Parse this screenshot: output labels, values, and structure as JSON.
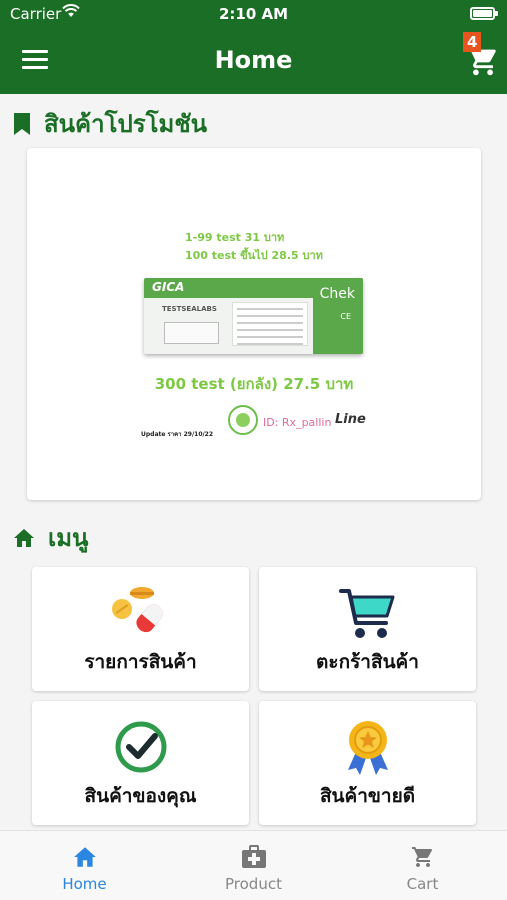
{
  "status_bar": {
    "carrier": "Carrier",
    "time": "2:10 AM"
  },
  "app_bar": {
    "title": "Home",
    "cart_badge": "4"
  },
  "promotion": {
    "heading": "สินค้าโปรโมชัน",
    "banner": {
      "line1": "1-99 test 31 บาท",
      "line2": "100  test ขึ้นไป 28.5 บาท",
      "main": "300 test (ยกลัง) 27.5 บาท",
      "update": "Update ราคา 29/10/22",
      "line_id": "ID: Rx_pallin",
      "line_brand": "Line",
      "kit_name": "GICA",
      "kit_brand": "TESTSEALABS",
      "kit_chek": "Chek",
      "kit_ce": "CE"
    }
  },
  "menu": {
    "heading": "เมนู",
    "items": [
      {
        "label": "รายการสินค้า",
        "icon": "pills-icon"
      },
      {
        "label": "ตะกร้าสินค้า",
        "icon": "shopping-cart-icon"
      },
      {
        "label": "สินค้าของคุณ",
        "icon": "check-circle-icon"
      },
      {
        "label": "สินค้าขายดี",
        "icon": "award-ribbon-icon"
      }
    ]
  },
  "tabs": [
    {
      "label": "Home",
      "icon": "home-icon",
      "active": true
    },
    {
      "label": "Product",
      "icon": "medkit-icon",
      "active": false
    },
    {
      "label": "Cart",
      "icon": "cart-icon",
      "active": false
    }
  ],
  "colors": {
    "primary_green": "#1b6e25",
    "badge_orange": "#e8541e",
    "promo_green": "#7dc844",
    "active_tab_blue": "#2a86e0",
    "inactive_tab_gray": "#888888"
  }
}
